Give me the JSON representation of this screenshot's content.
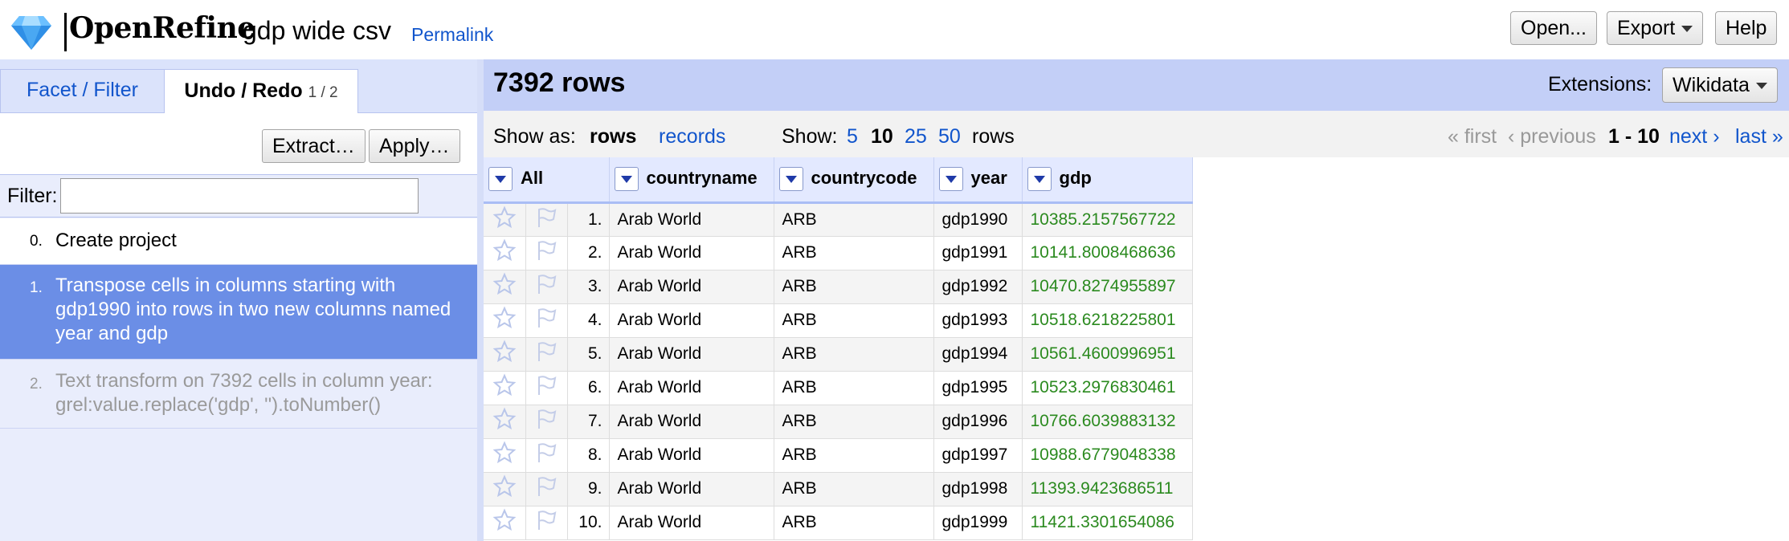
{
  "app": {
    "name": "OpenRefine",
    "project_name": "gdp wide csv",
    "permalink_label": "Permalink"
  },
  "header_buttons": {
    "open": "Open...",
    "export": "Export",
    "help": "Help"
  },
  "left_panel": {
    "tabs": {
      "facet_filter": "Facet / Filter",
      "undo_redo": "Undo / Redo",
      "undo_redo_count": "1 / 2"
    },
    "extract_label": "Extract…",
    "apply_label": "Apply…",
    "filter_label": "Filter:",
    "filter_value": "",
    "history": [
      {
        "num": "0.",
        "text": "Create project"
      },
      {
        "num": "1.",
        "text": "Transpose cells in columns starting with gdp1990 into rows in two new columns named year and gdp"
      },
      {
        "num": "2.",
        "text": "Text transform on 7392 cells in column year: grel:value.replace('gdp', '').toNumber()"
      }
    ]
  },
  "summary": {
    "row_count": "7392 rows",
    "extensions_label": "Extensions:",
    "wikidata_label": "Wikidata"
  },
  "view": {
    "show_as_label": "Show as:",
    "rows_label": "rows",
    "records_label": "records",
    "show_label": "Show:",
    "page_sizes": [
      "5",
      "10",
      "25",
      "50"
    ],
    "selected_page_size": "10",
    "rows_suffix": "rows",
    "first": "« first",
    "previous": "‹ previous",
    "range": "1 - 10",
    "next": "next ›",
    "last": "last »"
  },
  "table": {
    "all_label": "All",
    "columns": [
      "countryname",
      "countrycode",
      "year",
      "gdp"
    ],
    "rows": [
      {
        "idx": "1.",
        "countryname": "Arab World",
        "countrycode": "ARB",
        "year": "gdp1990",
        "gdp": "10385.2157567722"
      },
      {
        "idx": "2.",
        "countryname": "Arab World",
        "countrycode": "ARB",
        "year": "gdp1991",
        "gdp": "10141.8008468636"
      },
      {
        "idx": "3.",
        "countryname": "Arab World",
        "countrycode": "ARB",
        "year": "gdp1992",
        "gdp": "10470.8274955897"
      },
      {
        "idx": "4.",
        "countryname": "Arab World",
        "countrycode": "ARB",
        "year": "gdp1993",
        "gdp": "10518.6218225801"
      },
      {
        "idx": "5.",
        "countryname": "Arab World",
        "countrycode": "ARB",
        "year": "gdp1994",
        "gdp": "10561.4600996951"
      },
      {
        "idx": "6.",
        "countryname": "Arab World",
        "countrycode": "ARB",
        "year": "gdp1995",
        "gdp": "10523.2976830461"
      },
      {
        "idx": "7.",
        "countryname": "Arab World",
        "countrycode": "ARB",
        "year": "gdp1996",
        "gdp": "10766.6039883132"
      },
      {
        "idx": "8.",
        "countryname": "Arab World",
        "countrycode": "ARB",
        "year": "gdp1997",
        "gdp": "10988.6779048338"
      },
      {
        "idx": "9.",
        "countryname": "Arab World",
        "countrycode": "ARB",
        "year": "gdp1998",
        "gdp": "11393.9423686511"
      },
      {
        "idx": "10.",
        "countryname": "Arab World",
        "countrycode": "ARB",
        "year": "gdp1999",
        "gdp": "11421.3301654086"
      }
    ]
  },
  "colors": {
    "accent_blue": "#1155cc",
    "selected_history": "#6b8ee6",
    "summary_bar": "#c3cff7",
    "gdp_text": "#2b8a1f"
  },
  "icons": {
    "logo": "diamond-logo-icon",
    "star": "star-icon",
    "flag": "flag-icon",
    "dropdown": "column-dropdown-icon"
  }
}
